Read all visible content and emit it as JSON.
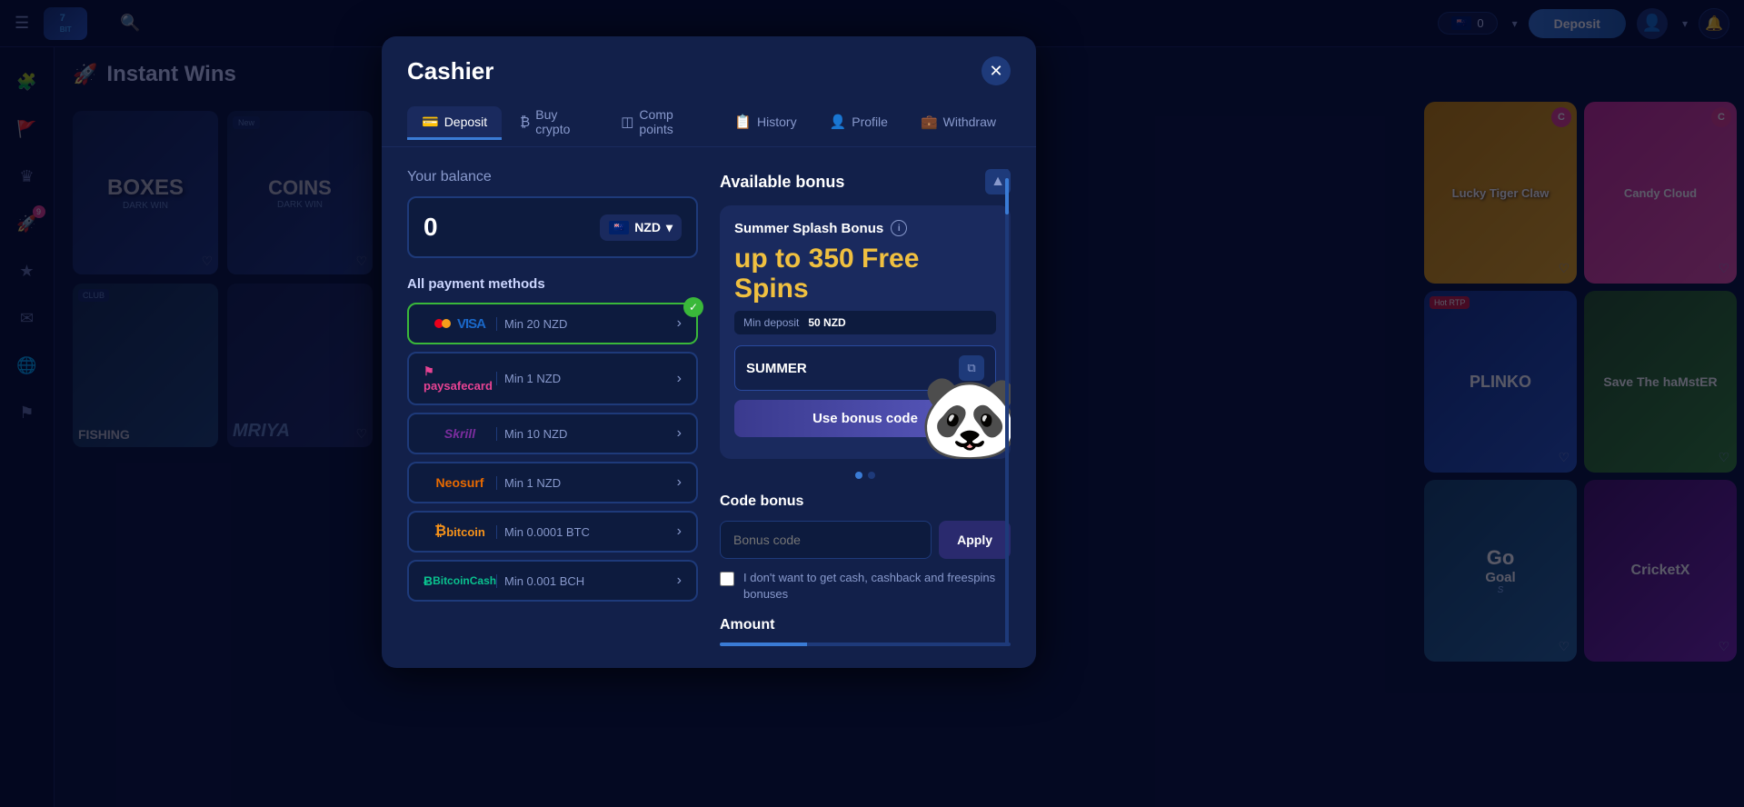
{
  "app": {
    "title": "7Bit Casino"
  },
  "navbar": {
    "balance": "0",
    "currency": "NZD",
    "deposit_label": "Deposit",
    "dropdown_arrow": "▾"
  },
  "sidebar": {
    "items": [
      {
        "name": "menu-icon",
        "icon": "☰"
      },
      {
        "name": "puzzle-icon",
        "icon": "🧩"
      },
      {
        "name": "flag-icon",
        "icon": "🚩"
      },
      {
        "name": "crown-icon",
        "icon": "♛"
      },
      {
        "name": "rocket-icon",
        "icon": "🚀"
      },
      {
        "name": "star-icon",
        "icon": "★"
      },
      {
        "name": "envelope-icon",
        "icon": "✉"
      },
      {
        "name": "globe-icon",
        "icon": "🌐"
      },
      {
        "name": "flag2-icon",
        "icon": "⚑"
      }
    ]
  },
  "page": {
    "title": "Instant Wins",
    "title_icon": "🚀"
  },
  "cashier": {
    "title": "Cashier",
    "close_icon": "✕",
    "tabs": [
      {
        "id": "deposit",
        "label": "Deposit",
        "icon": "💳",
        "active": true
      },
      {
        "id": "buy-crypto",
        "label": "Buy crypto",
        "icon": "₿"
      },
      {
        "id": "comp-points",
        "label": "Comp points",
        "icon": "◫"
      },
      {
        "id": "history",
        "label": "History",
        "icon": "📋"
      },
      {
        "id": "profile",
        "label": "Profile",
        "icon": "👤"
      },
      {
        "id": "withdraw",
        "label": "Withdraw",
        "icon": "💼"
      }
    ],
    "balance_label": "Your balance",
    "balance_amount": "0",
    "currency": "NZD",
    "payment_methods_label": "All payment methods",
    "payment_methods": [
      {
        "id": "visa",
        "name": "VISA",
        "min": "Min 20 NZD",
        "selected": true
      },
      {
        "id": "paysafecard",
        "name": "paysafecard",
        "min": "Min 1 NZD"
      },
      {
        "id": "skrill",
        "name": "Skrill",
        "min": "Min 10 NZD"
      },
      {
        "id": "neosurf",
        "name": "Neosurf",
        "min": "Min 1 NZD"
      },
      {
        "id": "bitcoin",
        "name": "bitcoin",
        "min": "Min 0.0001 BTC"
      },
      {
        "id": "bitcoin-cash",
        "name": "BitcoinCash",
        "min": "Min 0.001 BCH"
      }
    ]
  },
  "bonus_panel": {
    "title": "Available bonus",
    "collapse_icon": "▲",
    "bonus_card": {
      "name": "Summer Splash Bonus",
      "free_spins_text": "up to 350 Free Spins",
      "min_deposit_label": "Min deposit",
      "min_deposit_value": "50 NZD",
      "promo_code": "SUMMER",
      "copy_icon": "⧉",
      "use_bonus_label": "Use bonus code"
    },
    "dots": [
      {
        "active": true
      },
      {
        "active": false
      }
    ],
    "code_bonus_label": "Code bonus",
    "bonus_code_placeholder": "Bonus code",
    "apply_label": "Apply",
    "nocash_text": "I don't want to get cash, cashback and freespins bonuses",
    "amount_label": "Amount"
  },
  "right_cards": [
    {
      "id": "lucky-tiger",
      "label": "Lucky Tiger Claw",
      "badge": "C",
      "color1": "#c8860a",
      "color2": "#e8a820"
    },
    {
      "id": "candy-cloud",
      "label": "Candy Cloud",
      "badge": "C",
      "color1": "#cc3399",
      "color2": "#e855aa"
    },
    {
      "id": "plinko",
      "label": "Plinko",
      "badge_type": "hotrtp",
      "badge": "Hot RTP",
      "color1": "#1a3a8c",
      "color2": "#2a5ac0"
    },
    {
      "id": "save-hamster",
      "label": "Save The Hamster",
      "color1": "#2a5a2a",
      "color2": "#3a8a3a"
    },
    {
      "id": "go-goal",
      "label": "Go Goal",
      "color1": "#1a4a6e",
      "color2": "#2a6a9e"
    },
    {
      "id": "cricket",
      "label": "CricketX",
      "color1": "#4a1a6e",
      "color2": "#7a2ab0"
    }
  ]
}
